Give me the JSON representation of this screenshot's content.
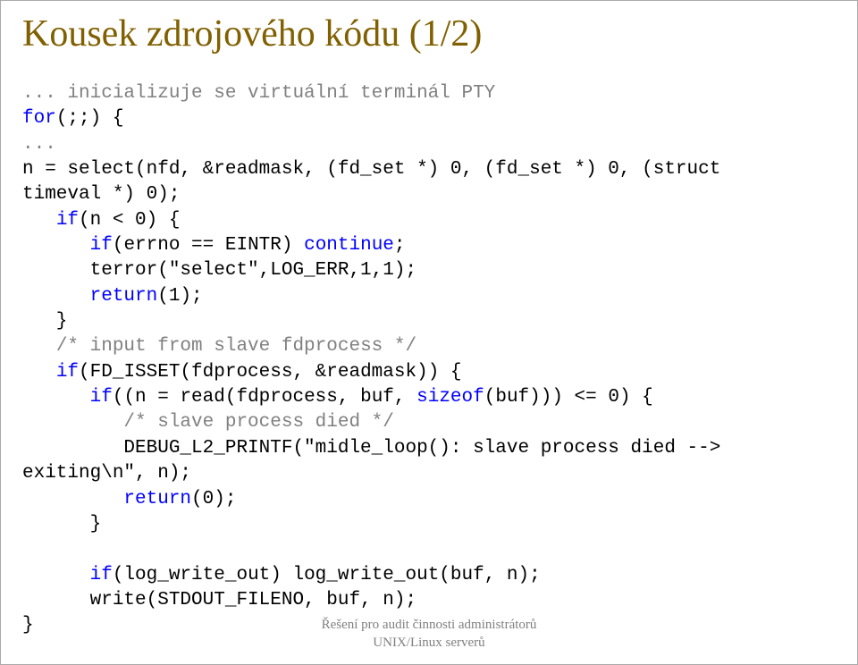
{
  "title": "Kousek zdrojového kódu (1/2)",
  "code": {
    "c1": "... inicializuje se virtuální terminál PTY",
    "l2a": "for",
    "l2b": "(;;) {",
    "c2": "...",
    "l3": "n = select(nfd, &readmask, (fd_set *) 0, (fd_set *) 0, (struct",
    "l4": "timeval *) 0);",
    "l5a": "   ",
    "l5k": "if",
    "l5b": "(n < 0) {",
    "l6a": "      ",
    "l6k": "if",
    "l6b": "(errno == EINTR) ",
    "l6c": "continue",
    "l6d": ";",
    "l7": "      terror(\"select\",LOG_ERR,1,1);",
    "l8a": "      ",
    "l8k": "return",
    "l8b": "(1);",
    "l9": "   }",
    "c3a": "   ",
    "c3b": "/* input from slave fdprocess */",
    "l10a": "   ",
    "l10k": "if",
    "l10b": "(FD_ISSET(fdprocess, &readmask)) {",
    "l11a": "      ",
    "l11k": "if",
    "l11b": "((n = read(fdprocess, buf, ",
    "l11c": "sizeof",
    "l11d": "(buf))) <= 0) {",
    "c4a": "         ",
    "c4b": "/* slave process died */",
    "l12": "         DEBUG_L2_PRINTF(\"midle_loop(): slave process died -->",
    "l13": "exiting\\n\", n);",
    "l14a": "         ",
    "l14k": "return",
    "l14b": "(0);",
    "l15": "      }",
    "blank": "",
    "l16a": "      ",
    "l16k": "if",
    "l16b": "(log_write_out) log_write_out(buf, n);",
    "l17": "      write(STDOUT_FILENO, buf, n);",
    "l18": "}"
  },
  "footer": {
    "line1": "Řešení pro audit činnosti administrátorů",
    "line2": "UNIX/Linux serverů"
  }
}
